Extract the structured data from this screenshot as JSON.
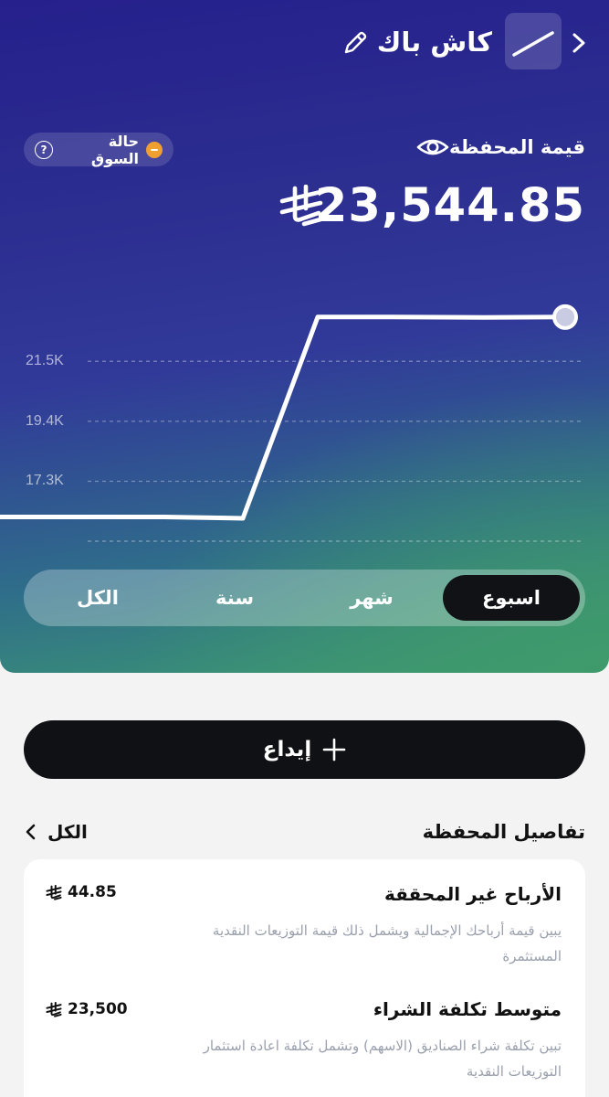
{
  "header": {
    "wallet_name": "كاش باك",
    "back_icon": "chevron-right-icon",
    "edit_icon": "pencil-icon"
  },
  "market": {
    "label": "حالة السوق",
    "status_color": "#f0a030",
    "help_icon": "question-icon"
  },
  "portfolio": {
    "title": "قيمة المحفظة",
    "value": "23,544.85",
    "currency_icon": "saudi-riyal-icon",
    "visibility_icon": "eye-icon"
  },
  "chart_data": {
    "type": "line",
    "title": "",
    "xlabel": "",
    "ylabel": "",
    "y_ticks": [
      "21.5K",
      "19.4K",
      "17.3K"
    ],
    "ylim": [
      15200,
      24550
    ],
    "grid": true,
    "series": [
      {
        "x": [
          0,
          1,
          2,
          3,
          4,
          5,
          6
        ],
        "values": [
          16050,
          16050,
          16000,
          23050,
          23050,
          23040,
          23050
        ],
        "color": "#ffffff"
      }
    ]
  },
  "periods": {
    "active": 0,
    "items": [
      {
        "label": "اسبوع"
      },
      {
        "label": "شهر"
      },
      {
        "label": "سنة"
      },
      {
        "label": "الكل"
      }
    ]
  },
  "deposit": {
    "label": "إيداع",
    "icon": "plus-icon"
  },
  "details": {
    "title": "تفاصيل المحفظة",
    "all_label": "الكل",
    "metrics": [
      {
        "title": "الأرباح غير المحققة",
        "desc": "يبين قيمة أرباحك الإجمالية ويشمل ذلك قيمة التوزيعات النقدية المستثمرة",
        "value": "44.85"
      },
      {
        "title": "متوسط تكلفة الشراء",
        "desc": "تبين تكلفة شراء الصناديق (الاسهم) وتشمل تكلفة اعادة استثمار التوزيعات النقدية",
        "value": "23,500"
      }
    ]
  },
  "colors": {
    "accent_dark": "#101114",
    "background": "#f3f3f4",
    "muted_text": "#9aa0ae"
  }
}
